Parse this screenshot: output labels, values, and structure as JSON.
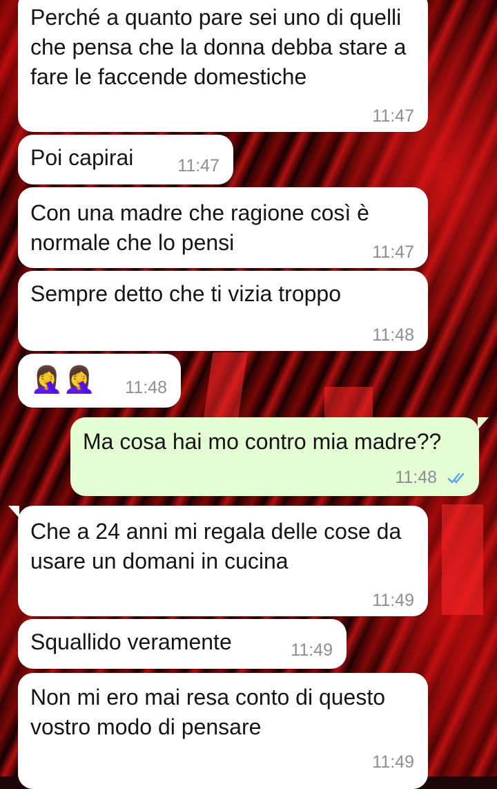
{
  "messages": [
    {
      "direction": "in",
      "text": "Perché a quanto pare sei uno di quelli che pensa che la donna debba stare a fare le faccende domestiche",
      "time": "11:47"
    },
    {
      "direction": "in",
      "text": "Poi capirai",
      "time": "11:47"
    },
    {
      "direction": "in",
      "text": "Con una madre che ragione così è normale che lo pensi",
      "time": "11:47"
    },
    {
      "direction": "in",
      "text": "Sempre detto che ti vizia troppo",
      "time": "11:48"
    },
    {
      "direction": "in",
      "text": "🤦‍♀️🤦‍♀️",
      "emoji": "woman-facepalming-icon",
      "time": "11:48"
    },
    {
      "direction": "out",
      "text": "Ma cosa hai mo contro mia madre??",
      "time": "11:48",
      "status": "read-double-check-icon",
      "status_color": "#4fa9e8"
    },
    {
      "direction": "in",
      "text": "Che a 24 anni mi regala delle cose da usare un domani in cucina",
      "time": "11:49"
    },
    {
      "direction": "in",
      "text": "Squallido veramente",
      "time": "11:49"
    },
    {
      "direction": "in",
      "text": "Non mi ero mai resa conto di questo vostro modo di pensare",
      "time": "11:49"
    }
  ],
  "colors": {
    "incoming_bubble": "#ffffff",
    "outgoing_bubble": "#e4fdd2",
    "timestamp": "#8a8f93",
    "read_ticks": "#4fa9e8",
    "wallpaper_accent": "#c41010"
  }
}
